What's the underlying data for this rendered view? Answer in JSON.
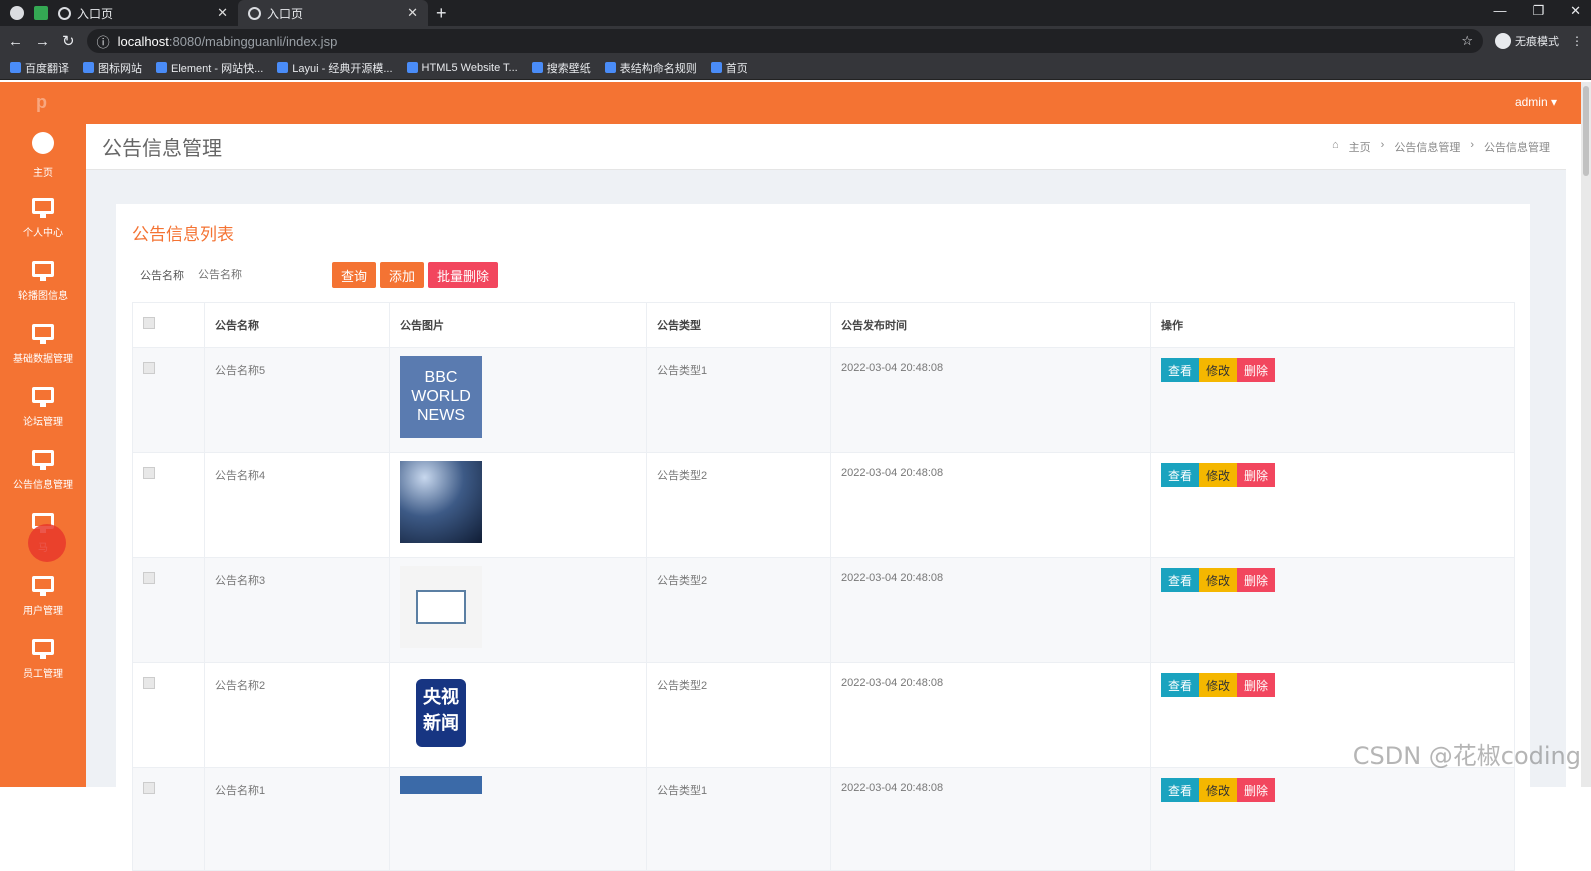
{
  "browser": {
    "tabs": [
      {
        "title": "入口页"
      },
      {
        "title": "入口页"
      }
    ],
    "url_host": "localhost",
    "url_path": ":8080/mabingguanli/index.jsp",
    "incognito_label": "无痕模式",
    "bookmarks": [
      "百度翻译",
      "图标网站",
      "Element - 网站快...",
      "Layui - 经典开源模...",
      "HTML5 Website T...",
      "搜索壁纸",
      "表结构命名规则",
      "首页"
    ]
  },
  "header": {
    "logo": "p",
    "user": "admin ▾"
  },
  "sidebar": {
    "items": [
      {
        "label": "主页",
        "icon": "dashboard-icon"
      },
      {
        "label": "个人中心",
        "icon": "monitor-icon"
      },
      {
        "label": "轮播图信息",
        "icon": "monitor-icon"
      },
      {
        "label": "基础数据管理",
        "icon": "monitor-icon"
      },
      {
        "label": "论坛管理",
        "icon": "monitor-icon"
      },
      {
        "label": "公告信息管理",
        "icon": "monitor-icon"
      },
      {
        "label": "马",
        "icon": "monitor-icon"
      },
      {
        "label": "用户管理",
        "icon": "monitor-icon"
      },
      {
        "label": "员工管理",
        "icon": "monitor-icon"
      }
    ]
  },
  "page": {
    "title": "公告信息管理",
    "breadcrumb": [
      "主页",
      "公告信息管理",
      "公告信息管理"
    ]
  },
  "card": {
    "heading": "公告信息列表",
    "filter_label": "公告名称",
    "filter_placeholder": "公告名称",
    "query_button": "查询",
    "add_button": "添加",
    "batch_delete_button": "批量删除"
  },
  "table": {
    "columns": [
      "",
      "公告名称",
      "公告图片",
      "公告类型",
      "公告发布时间",
      "操作"
    ],
    "actions": {
      "view": "查看",
      "edit": "修改",
      "delete": "删除"
    },
    "rows": [
      {
        "name": "公告名称5",
        "type": "公告类型1",
        "time": "2022-03-04 20:48:08",
        "image_text": "BBC\nWORLD\nNEWS"
      },
      {
        "name": "公告名称4",
        "type": "公告类型2",
        "time": "2022-03-04 20:48:08",
        "image_text": ""
      },
      {
        "name": "公告名称3",
        "type": "公告类型2",
        "time": "2022-03-04 20:48:08",
        "image_text": ""
      },
      {
        "name": "公告名称2",
        "type": "公告类型2",
        "time": "2022-03-04 20:48:08",
        "image_text": "央视\n新闻"
      },
      {
        "name": "公告名称1",
        "type": "公告类型1",
        "time": "2022-03-04 20:48:08",
        "image_text": ""
      }
    ]
  },
  "watermark": "CSDN @花椒coding"
}
